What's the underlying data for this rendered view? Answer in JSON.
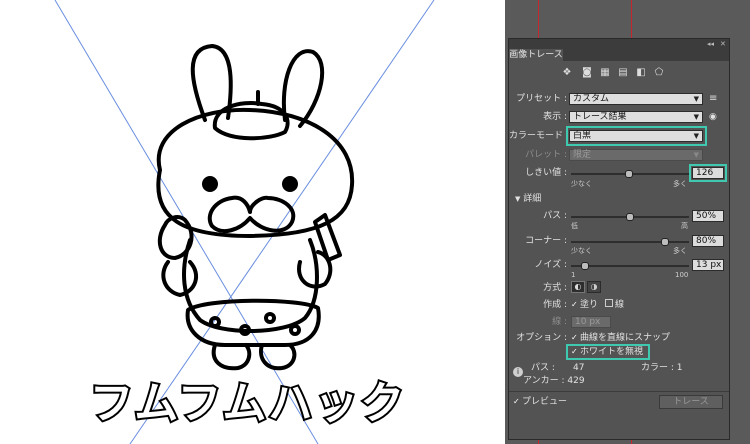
{
  "panel": {
    "title": "画像トレース",
    "window_controls": {
      "collapse": "◂◂",
      "close": "✕"
    },
    "icons": [
      "auto-color-icon",
      "high-color-icon",
      "low-color-icon",
      "grayscale-icon",
      "black-white-icon",
      "outline-icon"
    ],
    "preset": {
      "label": "プリセット :",
      "value": "カスタム"
    },
    "view": {
      "label": "表示 :",
      "value": "トレース結果"
    },
    "color_mode": {
      "label": "カラーモード :",
      "value": "白黒"
    },
    "palette": {
      "label": "パレット :",
      "value": "限定"
    },
    "threshold": {
      "label": "しきい値 :",
      "value": "126",
      "low": "少なく",
      "high": "多く",
      "level": 126,
      "min": 0,
      "max": 255
    },
    "details": {
      "header": "詳細",
      "paths": {
        "label": "パス :",
        "value": "50%",
        "low": "低",
        "high": "高",
        "level": 0.5
      },
      "corners": {
        "label": "コーナー :",
        "value": "80%",
        "low": "少なく",
        "high": "多く",
        "level": 0.8
      },
      "noise": {
        "label": "ノイズ :",
        "value": "13 px",
        "low": "1",
        "high": "100",
        "level": 13,
        "min": 1,
        "max": 100
      },
      "method": {
        "label": "方式 :"
      },
      "create": {
        "label": "作成 :",
        "fill": "塗り",
        "stroke": "線"
      },
      "stroke_width": {
        "label": "線 :",
        "value": "10 px"
      },
      "options": {
        "label": "オプション :",
        "snap": "曲線を直線にスナップ",
        "ignore_white": "ホワイトを無視"
      }
    },
    "stats": {
      "paths_label": "パス :",
      "paths_value": "47",
      "colors_label": "カラー :",
      "colors_value": "1",
      "anchors_label": "アンカー :",
      "anchors_value": "429"
    },
    "preview": "プレビュー",
    "trace_button": "トレース"
  },
  "artwork": {
    "text": "フムフムハック"
  },
  "colors": {
    "highlight": "#3ec9b0",
    "guide": "#c8262e",
    "crossline": "#6a8fe0"
  }
}
